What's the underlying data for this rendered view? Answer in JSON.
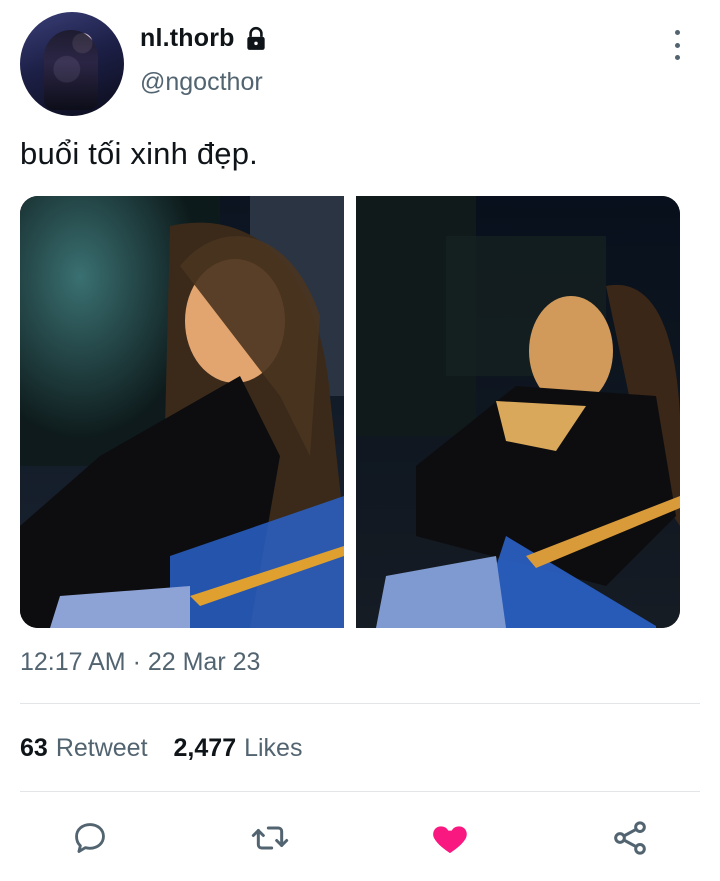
{
  "user": {
    "display_name": "nl.thorb",
    "handle": "@ngocthor",
    "lock_icon": "lock-icon",
    "more_icon": "more-vertical-icon"
  },
  "tweet": {
    "text": "buổi tối xinh đẹp.",
    "timestamp": "12:17 AM · 22 Mar 23"
  },
  "stats": {
    "retweets_count": "63",
    "retweets_label": "Retweet",
    "likes_count": "2,477",
    "likes_label": "Likes"
  },
  "actions": [
    {
      "name": "reply-icon"
    },
    {
      "name": "retweet-icon"
    },
    {
      "name": "like-icon",
      "color": "#f91880",
      "state": "liked"
    },
    {
      "name": "share-icon"
    }
  ],
  "colors": {
    "text_primary": "#0f1419",
    "text_secondary": "#536471",
    "like": "#f91880",
    "divider": "#e3e6e8"
  }
}
